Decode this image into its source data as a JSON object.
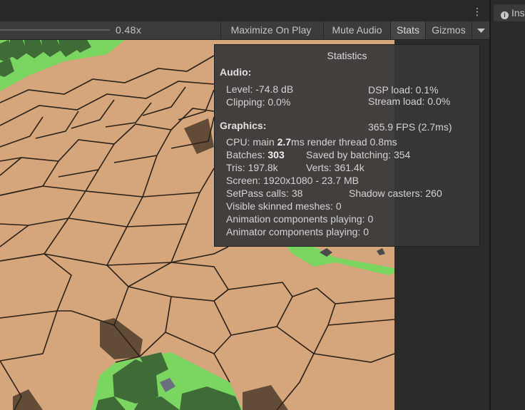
{
  "toolbar": {
    "scale_value": "0.48x",
    "maximize_label": "Maximize On Play",
    "mute_label": "Mute Audio",
    "stats_label": "Stats",
    "gizmos_label": "Gizmos",
    "menu_icon": "kebab-menu-icon",
    "dropdown_icon": "dropdown-arrow-icon"
  },
  "inspector": {
    "tab_label": "Ins",
    "icon": "info-icon"
  },
  "stats": {
    "title": "Statistics",
    "audio_header": "Audio:",
    "level": "Level: -74.8 dB",
    "dsp_load": "DSP load: 0.1%",
    "clipping": "Clipping: 0.0%",
    "stream_load": "Stream load: 0.0%",
    "graphics_header": "Graphics:",
    "fps": "365.9 FPS (2.7ms)",
    "cpu_prefix": "CPU: main ",
    "cpu_main": "2.7",
    "cpu_suffix": "ms  render thread 0.8ms",
    "batches_prefix": "Batches: ",
    "batches_value": "303",
    "saved_by_batching": "Saved by batching: 354",
    "tris": "Tris: 197.8k",
    "verts": "Verts: 361.4k",
    "screen": "Screen: 1920x1080 - 23.7 MB",
    "setpass": "SetPass calls: 38",
    "shadow_casters": "Shadow casters: 260",
    "skinned_meshes": "Visible skinned meshes: 0",
    "animation_components": "Animation components playing: 0",
    "animator_components": "Animator components playing: 0"
  },
  "colors": {
    "toolbar_bg": "#3c3c3c",
    "panel_bg": "#373737",
    "tile": "#d5a67c",
    "grass": "#7bd561",
    "tree": "#3f6b36"
  }
}
